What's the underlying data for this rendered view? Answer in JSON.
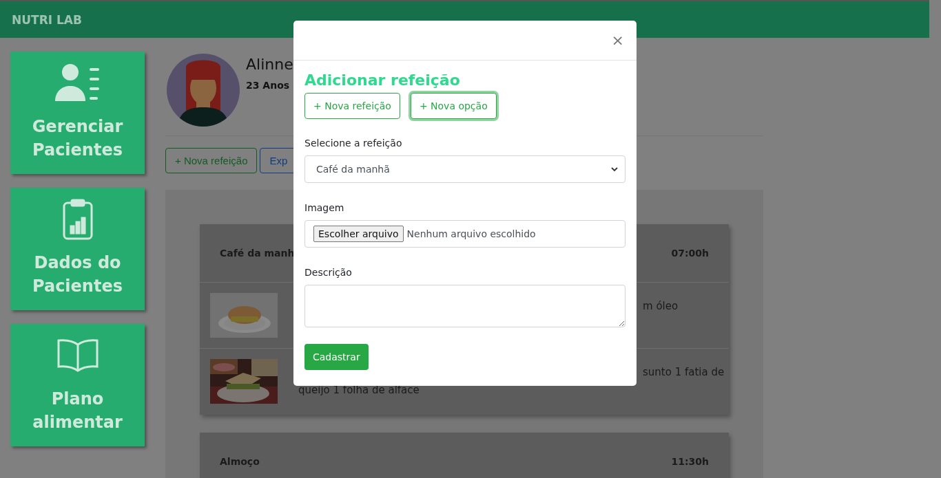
{
  "header": {
    "brand": "NUTRI LAB"
  },
  "sidebar": {
    "items": [
      {
        "kind": "patients",
        "label": "Gerenciar Pacientes"
      },
      {
        "kind": "data",
        "label": "Dados do Pacientes"
      },
      {
        "kind": "plan",
        "label": "Plano alimentar"
      }
    ]
  },
  "patient": {
    "name": "Alinne",
    "age": "23 Anos"
  },
  "actions": [
    {
      "kind": "green",
      "label": "+ Nova refeição"
    },
    {
      "kind": "blue",
      "label": "Exp"
    }
  ],
  "meals": [
    {
      "name": "Café da manh",
      "time": "07:00h",
      "options": [
        {
          "text_right": "m óleo"
        },
        {
          "text_right": "sunto 1 fatia de",
          "text_below": "queijo 1 folha de alface"
        }
      ]
    },
    {
      "name": "Almoço",
      "time": "11:30h"
    }
  ],
  "modal": {
    "close": "×",
    "title": "Adicionar refeição",
    "buttons": [
      {
        "label": "+ Nova refeição",
        "focused": false
      },
      {
        "label": "+ Nova opção",
        "focused": true
      }
    ],
    "meal_label": "Selecione a refeição",
    "meal_value": "Café da manhã",
    "image_label": "Imagem",
    "file_button": "Escolher arquivo",
    "file_status": "Nenhum arquivo escolhido",
    "description_label": "Descrição",
    "submit": "Cadastrar"
  }
}
